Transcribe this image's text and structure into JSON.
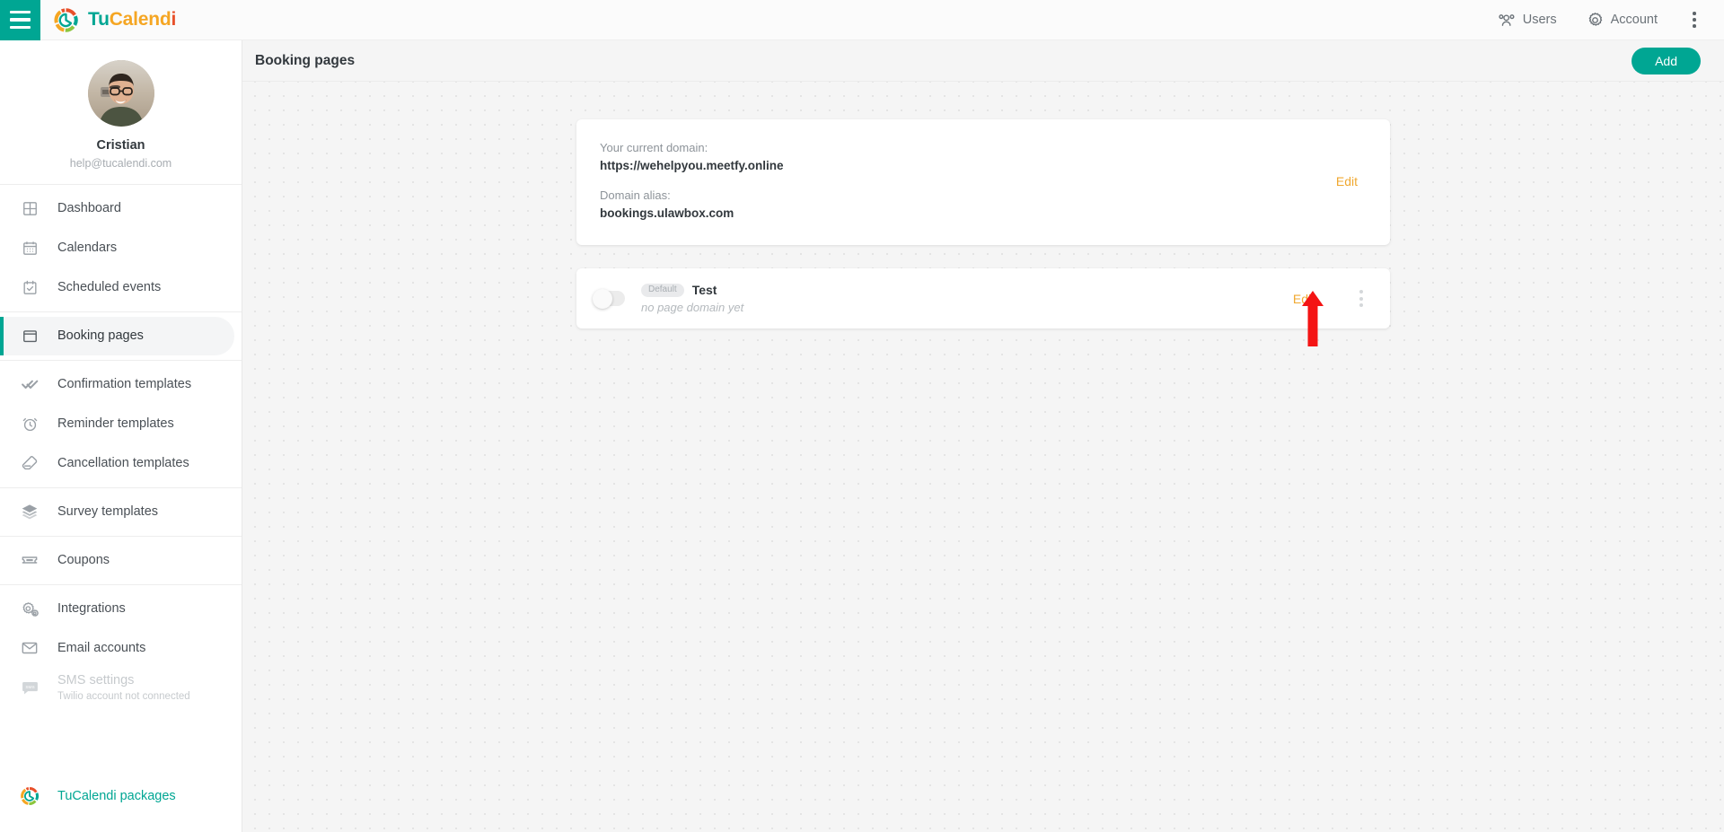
{
  "topbar": {
    "menu_icon": "hamburger-icon",
    "brand": {
      "part1": "Tu",
      "part2": "Calend",
      "part3": "i",
      "logo_icon": "tucalendi-logo-icon"
    },
    "users_label": "Users",
    "users_icon": "users-icon",
    "account_label": "Account",
    "account_icon": "gear-icon",
    "overflow_icon": "kebab-menu-icon"
  },
  "sidebar": {
    "profile": {
      "name": "Cristian",
      "email": "help@tucalendi.com",
      "avatar_icon": "user-avatar-photo"
    },
    "groups": [
      {
        "items": [
          {
            "label": "Dashboard",
            "icon": "dashboard-grid-icon",
            "active": false
          },
          {
            "label": "Calendars",
            "icon": "calendar-icon",
            "active": false
          },
          {
            "label": "Scheduled events",
            "icon": "calendar-check-icon",
            "active": false
          }
        ]
      },
      {
        "items": [
          {
            "label": "Booking pages",
            "icon": "browser-window-icon",
            "active": true
          }
        ]
      },
      {
        "items": [
          {
            "label": "Confirmation templates",
            "icon": "double-check-icon",
            "active": false
          },
          {
            "label": "Reminder templates",
            "icon": "alarm-clock-icon",
            "active": false
          },
          {
            "label": "Cancellation templates",
            "icon": "eraser-icon",
            "active": false
          }
        ]
      },
      {
        "items": [
          {
            "label": "Survey templates",
            "icon": "layers-icon",
            "active": false
          }
        ]
      },
      {
        "items": [
          {
            "label": "Coupons",
            "icon": "ticket-icon",
            "active": false
          }
        ]
      },
      {
        "items": [
          {
            "label": "Integrations",
            "icon": "gears-icon",
            "active": false
          },
          {
            "label": "Email accounts",
            "icon": "envelope-icon",
            "active": false
          },
          {
            "label": "SMS settings",
            "sublabel": "Twilio account not connected",
            "icon": "sms-bubble-icon",
            "active": false,
            "disabled": true
          }
        ]
      }
    ],
    "packages": {
      "label": "TuCalendi packages",
      "icon": "tucalendi-logo-icon"
    }
  },
  "main": {
    "title": "Booking pages",
    "add_button": "Add",
    "domain_card": {
      "current_domain_label": "Your current domain:",
      "current_domain_value": "https://wehelpyou.meetfy.online",
      "alias_label": "Domain alias:",
      "alias_value": "bookings.ulawbox.com",
      "edit_label": "Edit"
    },
    "booking_page_row": {
      "toggle_state": "off",
      "badge": "Default",
      "name": "Test",
      "subtitle": "no page domain yet",
      "edit_label": "Edit",
      "menu_icon": "kebab-menu-icon"
    },
    "annotation": {
      "arrow_icon": "red-up-arrow-annotation",
      "color": "#f41414"
    }
  },
  "colors": {
    "accent_teal": "#00a693",
    "edit_orange": "#f0a830",
    "annotation_red": "#f41414"
  }
}
